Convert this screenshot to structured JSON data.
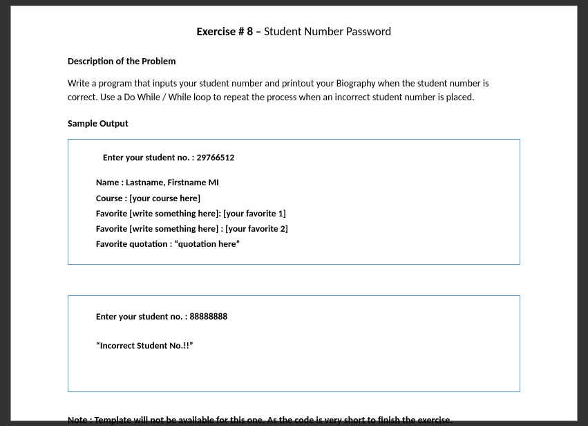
{
  "title": {
    "bold_part": "Exercise # 8 – ",
    "normal_part": "Student Number Password"
  },
  "description": {
    "heading": "Description of the Problem",
    "body": "Write a program that inputs your student number and printout your Biography when the student number is correct. Use a Do While / While loop to repeat the process when an incorrect student number is placed."
  },
  "sample_output_heading": "Sample Output",
  "output1": {
    "prompt": "Enter your student no. : 29766512",
    "lines": [
      "Name : Lastname, Firstname MI",
      "Course : [your course here]",
      "Favorite [write something here]: [your favorite 1]",
      "Favorite [write something here] : [your favorite 2]",
      "Favorite quotation : “quotation here”"
    ]
  },
  "output2": {
    "prompt": "Enter your student no. : 88888888",
    "message": "“Incorrect Student No.!!”"
  },
  "note": "Note : Template will not be available for this one. As the code is very short to finish the exercise."
}
